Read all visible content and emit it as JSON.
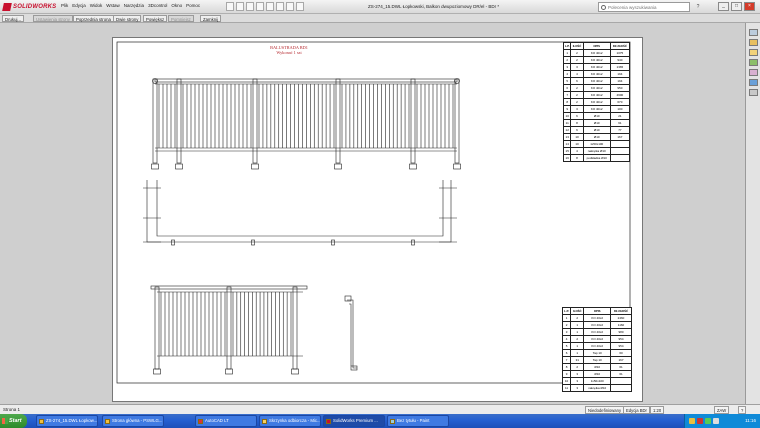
{
  "app": {
    "brand": "SOLIDWORKS",
    "menu": [
      "Plik",
      "Edycja",
      "Widok",
      "Wstaw",
      "Narzędzia",
      "3Dcontrol",
      "Okno",
      "Pomoc"
    ],
    "document_title": "ZS-274_15.DWL Łopkowski, Balkon dwupoziomowy DR/el - BDr *",
    "search_placeholder": "Polecenia wyszukiwania",
    "help_symbol": "?"
  },
  "command_tabs": [
    {
      "label": "Drukuj...",
      "enabled": true
    },
    {
      "label": "Ustawienia strony",
      "enabled": false
    },
    {
      "label": "Poprzednia strona",
      "enabled": true
    },
    {
      "label": "Dwie strony",
      "enabled": true
    },
    {
      "label": "Powiększ",
      "enabled": true
    },
    {
      "label": "Pomniejsz",
      "enabled": false
    },
    {
      "label": "Zamknij",
      "enabled": true
    }
  ],
  "drawing": {
    "title": "BALUSTRADA BD1",
    "subtitle": "Wykonać 1 szt"
  },
  "bom1": {
    "headers": [
      "L.P.",
      "ILOŚĆ",
      "OPIS",
      "DŁUGOŚĆ"
    ],
    "rows": [
      [
        "1",
        "2",
        "KO 40x2",
        "1075"
      ],
      [
        "2",
        "2",
        "KO 40x2",
        "940"
      ],
      [
        "3",
        "3",
        "KO 40x2",
        "1365"
      ],
      [
        "4",
        "4",
        "KO 40x2",
        "194"
      ],
      [
        "5",
        "6",
        "KO 40x2",
        "194"
      ],
      [
        "6",
        "2",
        "KO 40x2",
        "950"
      ],
      [
        "7",
        "2",
        "KO 40x2",
        "4600"
      ],
      [
        "8",
        "2",
        "KO 40x2",
        "670"
      ],
      [
        "9",
        "3",
        "KO 40x2",
        "100"
      ],
      [
        "10",
        "6",
        "Ø10",
        "21"
      ],
      [
        "11",
        "8",
        "Ø10",
        "61"
      ],
      [
        "12",
        "6",
        "Ø10",
        "77"
      ],
      [
        "13",
        "10",
        "Ø10",
        "167"
      ],
      [
        "14",
        "10",
        "1x50x100",
        ""
      ],
      [
        "15",
        "4",
        "nakrętka Ø10",
        ""
      ],
      [
        "16",
        "8",
        "podkładka Ø10",
        ""
      ]
    ]
  },
  "bom2": {
    "headers": [
      "L.P.",
      "ILOŚĆ",
      "OPIS",
      "DŁUGOŚĆ"
    ],
    "rows": [
      [
        "1",
        "2",
        "KO 40x2",
        "2460"
      ],
      [
        "2",
        "1",
        "KO 40x2",
        "1160"
      ],
      [
        "3",
        "1",
        "KO 40x2",
        "980"
      ],
      [
        "4",
        "2",
        "KO 40x2",
        "954"
      ],
      [
        "5",
        "1",
        "KO 40x2",
        "954"
      ],
      [
        "6",
        "1",
        "Tap 10",
        "60"
      ],
      [
        "7",
        "31",
        "Tap 10",
        "167"
      ],
      [
        "8",
        "2",
        "Ø10",
        "61"
      ],
      [
        "9",
        "3",
        "Ø10",
        "61"
      ],
      [
        "10",
        "3",
        "1x50x100",
        ""
      ],
      [
        "11",
        "3",
        "nakrętka Ø10",
        ""
      ]
    ]
  },
  "status": {
    "left": "Strona 1",
    "items": [
      "Niedodefiniowany",
      "Edycja BDr",
      "1:20",
      "ZAW",
      "?"
    ]
  },
  "taskbar": {
    "start": "Start",
    "tasks": [
      {
        "label": "ZS-274_15.DWL Łopkow..."
      },
      {
        "label": "Strona główna - PSWLG..."
      },
      {
        "label": "AutoCAD LT"
      },
      {
        "label": "Skrzynka odbiorcza - Mic..."
      },
      {
        "label": "SolidWorks Premium ..."
      },
      {
        "label": "Bez tytułu - Paint"
      }
    ],
    "clock": "11:16"
  },
  "colors": {
    "accent_red": "#c8102e",
    "title_red": "#b5282e",
    "taskbar_blue": "#245fd1"
  }
}
